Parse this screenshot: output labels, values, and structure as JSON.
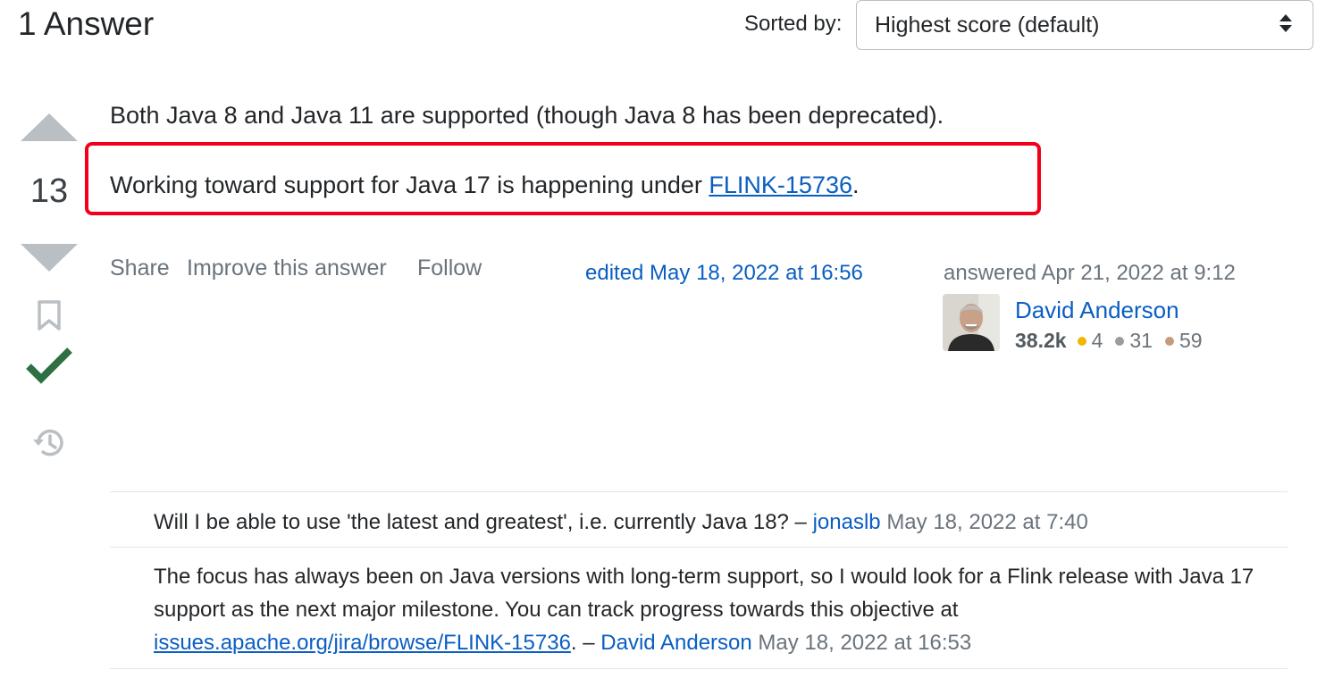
{
  "header": {
    "answers_count": "1 Answer",
    "sort_label": "Sorted by:",
    "sort_value": "Highest score (default)"
  },
  "vote": {
    "score": "13",
    "accepted": true
  },
  "answer": {
    "paragraph1": "Both Java 8 and Java 11 are supported (though Java 8 has been deprecated).",
    "paragraph2_prefix": "Working toward support for Java 17 is happening under ",
    "paragraph2_link": "FLINK-15736",
    "paragraph2_suffix": ".",
    "highlight_color": "#f2001a"
  },
  "post_menu": {
    "share": "Share",
    "improve": "Improve this answer",
    "follow": "Follow"
  },
  "edited": "edited May 18, 2022 at 16:56",
  "answered": "answered Apr 21, 2022 at 9:12",
  "user": {
    "name": "David Anderson",
    "reputation": "38.2k",
    "gold": "4",
    "silver": "31",
    "bronze": "59",
    "gold_color": "#f1b600",
    "silver_color": "#9a9c9f",
    "bronze_color": "#ab8a5f"
  },
  "comments": [
    {
      "text": "Will I be able to use 'the latest and greatest', i.e. currently Java 18? – ",
      "author": "jonaslb",
      "date": "May 18, 2022 at 7:40"
    },
    {
      "text": "The focus has always been on Java versions with long-term support, so I would look for a Flink release with Java 17 support as the next major milestone. You can track progress towards this objective at ",
      "link": "issues.apache.org/jira/browse/FLINK-15736",
      "after_link": ". – ",
      "author": "David Anderson",
      "date": "May 18, 2022 at 16:53"
    }
  ],
  "icons": {
    "vote_up": "triangle-up-icon",
    "vote_down": "triangle-down-icon",
    "bookmark": "bookmark-icon",
    "accepted": "checkmark-icon",
    "history": "history-icon",
    "sort_arrows": "sort-arrows-icon"
  }
}
